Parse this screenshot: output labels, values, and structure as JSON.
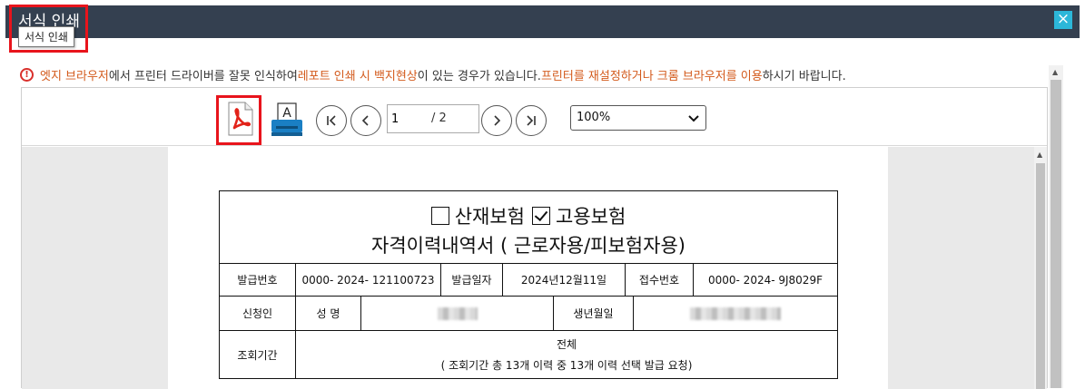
{
  "window": {
    "title": "서식 인쇄",
    "tooltip": "서식 인쇄",
    "close_icon": "×"
  },
  "notice": {
    "icon": "!",
    "segments": [
      {
        "text": "엣지 브라우저",
        "highlight": true
      },
      {
        "text": "에서 프린터 드라이버를 잘못 인식하여 ",
        "highlight": false
      },
      {
        "text": "레포트 인쇄 시 백지현상",
        "highlight": true
      },
      {
        "text": "이 있는 경우가 있습니다. ",
        "highlight": false
      },
      {
        "text": "프린터를 재설정하거나 크롬 브라우저를 이용",
        "highlight": true
      },
      {
        "text": "하시기 바랍니다.",
        "highlight": false
      }
    ],
    "highlight_color": "#d35a1c"
  },
  "toolbar": {
    "print_label": "A",
    "page_current": "1",
    "page_total": "/ 2",
    "zoom": "100%"
  },
  "form": {
    "title_line1_a": "산재보험",
    "title_line1_b": "고용보험",
    "title_line2": "자격이력내역서 ( 근로자용/피보험자용)",
    "issue_no_label": "발급번호",
    "issue_no_value": "0000- 2024- 121100723",
    "issue_date_label": "발급일자",
    "issue_date_value": "2024년12월11일",
    "receipt_no_label": "접수번호",
    "receipt_no_value": "0000- 2024- 9J8029F",
    "applicant_label": "신청인",
    "name_label": "성 명",
    "birth_label": "생년월일",
    "period_label": "조회기간",
    "period_value": "전체",
    "period_note": "( 조회기간 총 13개 이력 중 13개 이력 선택 발급 요청)"
  },
  "colors": {
    "titlebar": "#344050",
    "highlight_box": "#e8141c",
    "pdf_red": "#e2231a",
    "print_blue": "#1a7fc4"
  }
}
